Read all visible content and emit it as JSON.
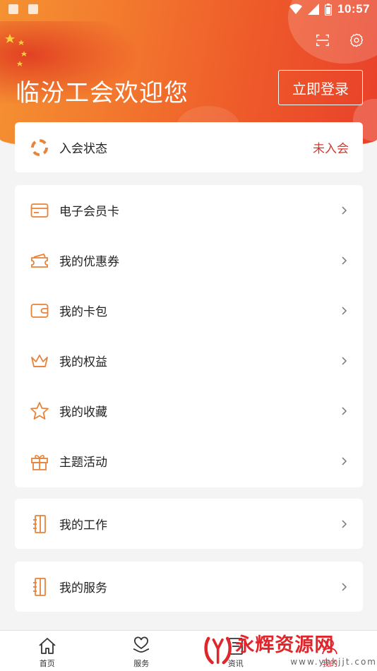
{
  "status_bar": {
    "time": "10:57",
    "icons": [
      "mail-icon",
      "app-a-icon",
      "wifi-icon",
      "signal-icon",
      "battery-icon"
    ]
  },
  "header": {
    "welcome_text": "临汾工会欢迎您",
    "login_button": "立即登录",
    "actions": [
      "scan-icon",
      "settings-icon"
    ]
  },
  "membership": {
    "label": "入会状态",
    "value": "未入会",
    "icon": "lifebuoy-icon"
  },
  "menu": [
    {
      "label": "电子会员卡",
      "icon": "card-icon"
    },
    {
      "label": "我的优惠券",
      "icon": "coupon-icon"
    },
    {
      "label": "我的卡包",
      "icon": "wallet-icon"
    },
    {
      "label": "我的权益",
      "icon": "crown-icon"
    },
    {
      "label": "我的收藏",
      "icon": "star-icon"
    },
    {
      "label": "主题活动",
      "icon": "gift-icon"
    }
  ],
  "work": {
    "label": "我的工作",
    "icon": "notebook-icon"
  },
  "service": {
    "label": "我的服务",
    "icon": "notebook-icon"
  },
  "bottom_nav": [
    {
      "label": "首页",
      "icon": "home-icon"
    },
    {
      "label": "服务",
      "icon": "heart-hand-icon"
    },
    {
      "label": "资讯",
      "icon": "news-icon"
    },
    {
      "label": "我的",
      "icon": "user-icon"
    }
  ],
  "watermark": {
    "title": "永辉资源网",
    "url": "www.yhkjjt.com"
  },
  "colors": {
    "accent": "#d9362a",
    "icon_orange": "#e8833a",
    "header_start": "#f49232",
    "header_end": "#e9402a"
  }
}
